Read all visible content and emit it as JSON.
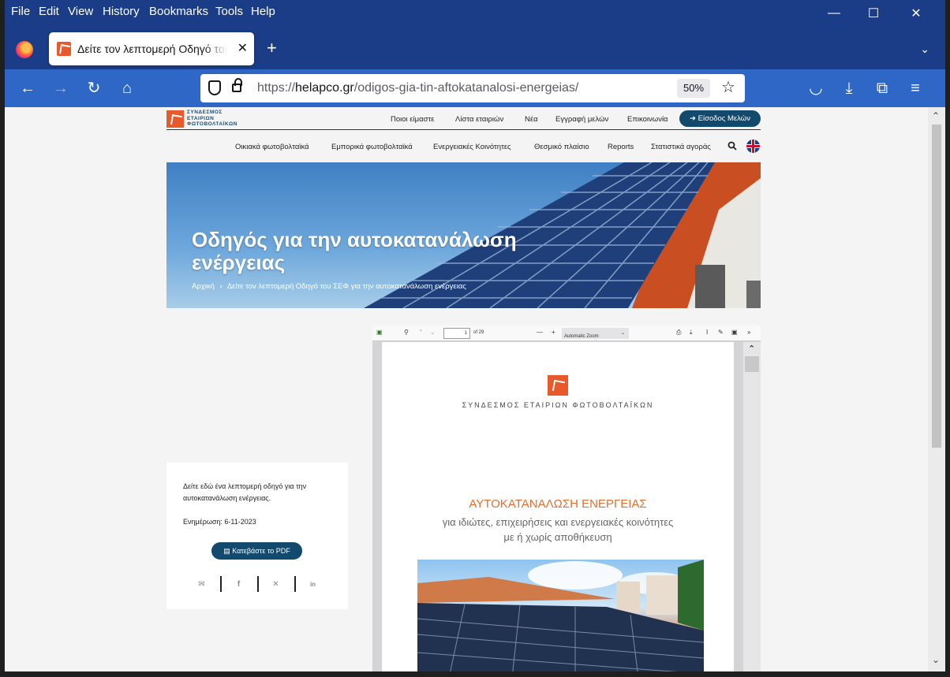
{
  "menu": [
    "File",
    "Edit",
    "View",
    "History",
    "Bookmarks",
    "Tools",
    "Help"
  ],
  "window_controls": {
    "minimize": "—",
    "maximize": "☐",
    "close": "✕"
  },
  "tab": {
    "title": "Δείτε τον λεπτομερή Οδηγό του ΣΕΦ",
    "close": "✕",
    "new_tab": "+",
    "list": "⌄"
  },
  "nav": {
    "back": "←",
    "forward": "→",
    "reload": "↻",
    "home": "⌂",
    "url_host": "helapco.gr",
    "url_prefix": "https://",
    "url_path": "/odigos-gia-tin-aftokatanalosi-energeias/",
    "zoom": "50%",
    "bookmark": "☆",
    "pocket": "◡",
    "download": "⤓",
    "extensions": "⧉",
    "menu": "≡"
  },
  "site": {
    "logo_lines": [
      "ΣΥΝΔΕΣΜΟΣ",
      "ΕΤΑΙΡΙΩΝ",
      "ΦΩΤΟΒΟΛΤΑΪΚΩΝ"
    ],
    "top_nav": [
      "Ποιοι είμαστε",
      "Λίστα εταιριών",
      "Νέα",
      "Εγγραφή μελών",
      "Επικοινωνία"
    ],
    "login": "Είσοδος Μελών",
    "sub_nav": [
      "Οικιακά φωτοβολταϊκά",
      "Εμπορικά φωτοβολταϊκά",
      "Ενεργειακές Κοινότητες",
      "Θεσμικό πλαίσιο",
      "Reports",
      "Στατιστικά αγοράς"
    ],
    "hero_title_1": "Οδηγός για την αυτοκατανάλωση",
    "hero_title_2": "ενέργειας",
    "crumb_home": "Αρχική",
    "crumb_sep": "›",
    "crumb_current": "Δείτε τον λεπτομερή Οδηγό του ΣΕΦ για την αυτοκατανάλωση ενέργειας",
    "card_desc": "Δείτε εδώ ένα λεπτομερή οδηγό για την αυτοκατανάλωση ενέργειας.",
    "card_date": "Ενημέρωση: 6-11-2023",
    "download": "Κατεβάστε το PDF",
    "share": {
      "email": "✉",
      "facebook": "f",
      "x": "✕",
      "linkedin": "in"
    }
  },
  "pdf": {
    "page_num": "1",
    "page_total": "of 29",
    "zoom": "Automatic Zoom",
    "zoom_out": "—",
    "zoom_in": "+",
    "org": "ΣΥΝΔΕΣΜΟΣ ΕΤΑΙΡΙΩΝ ΦΩΤΟΒΟΛΤΑΪΚΩΝ",
    "title": "ΑΥΤΟΚΑΤΑΝΑΛΩΣΗ ΕΝΕΡΓΕΙΑΣ",
    "subtitle1": "για ιδιώτες, επιχειρήσεις και ενεργειακές κοινότητες",
    "subtitle2": "με ή χωρίς αποθήκευση"
  }
}
